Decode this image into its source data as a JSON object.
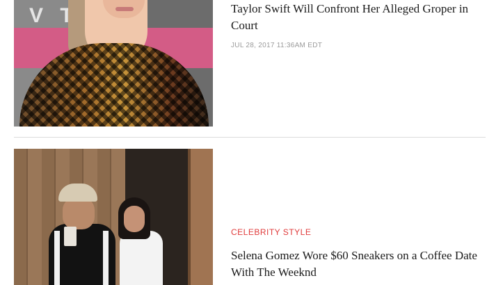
{
  "articles": [
    {
      "headline": "Taylor Swift Will Confront Her Alleged Groper in Court",
      "timestamp": "JUL 28, 2017 11:36AM EDT",
      "thumbnail_letters": "V T E O"
    },
    {
      "category": "CELEBRITY STYLE",
      "headline": "Selena Gomez Wore $60 Sneakers on a Coffee Date With The Weeknd"
    }
  ],
  "colors": {
    "category": "#e03b3b",
    "timestamp": "#9a9a9a",
    "headline": "#1a1a1a",
    "divider": "#dcdcdc"
  }
}
